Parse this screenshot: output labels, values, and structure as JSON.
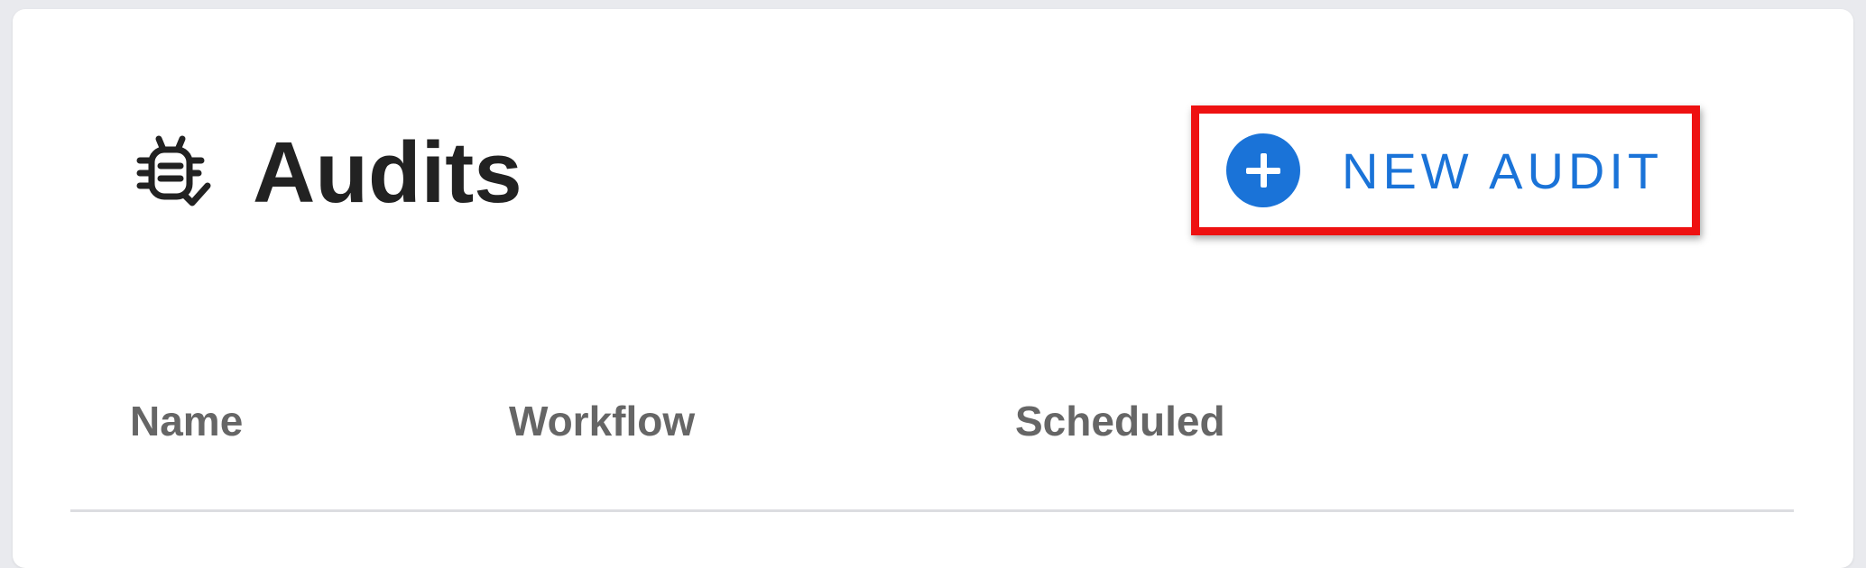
{
  "page": {
    "title": "Audits",
    "title_icon": "bug-check-icon"
  },
  "actions": {
    "new_audit_label": "NEW AUDIT",
    "new_audit_icon": "plus-circle-icon",
    "accent_color": "#1a73d8",
    "highlight_color": "#ee1111"
  },
  "table": {
    "columns": [
      "Name",
      "Workflow",
      "Scheduled"
    ]
  }
}
